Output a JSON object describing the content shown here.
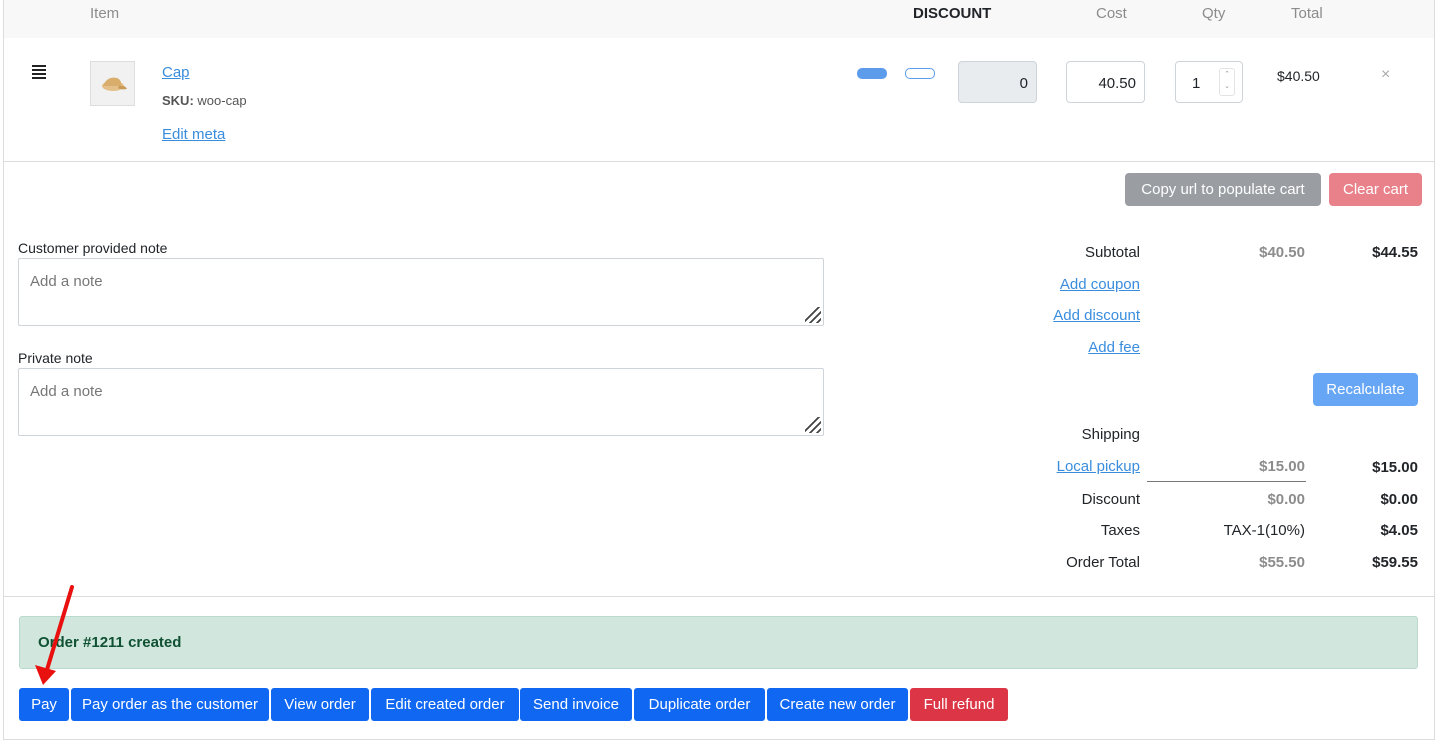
{
  "table_header": {
    "item": "Item",
    "discount": "DISCOUNT",
    "cost": "Cost",
    "qty": "Qty",
    "total": "Total"
  },
  "line_item": {
    "name": "Cap",
    "sku_label": "SKU:",
    "sku": "woo-cap",
    "edit_meta": "Edit meta",
    "discount_value": "0",
    "cost_value": "40.50",
    "qty_value": "1",
    "total": "$40.50",
    "remove_symbol": "×"
  },
  "cart_actions": {
    "copy_url": "Copy url to populate cart",
    "clear_cart": "Clear cart"
  },
  "notes": {
    "customer_label": "Customer provided note",
    "customer_placeholder": "Add a note",
    "private_label": "Private note",
    "private_placeholder": "Add a note"
  },
  "totals": {
    "subtotal_label": "Subtotal",
    "subtotal_orig": "$40.50",
    "subtotal_final": "$44.55",
    "add_coupon": "Add coupon",
    "add_discount": "Add discount",
    "add_fee": "Add fee",
    "recalculate": "Recalculate",
    "shipping_label": "Shipping",
    "shipping_method": "Local pickup",
    "shipping_orig": "$15.00",
    "shipping_final": "$15.00",
    "discount_label": "Discount",
    "discount_orig": "$0.00",
    "discount_final": "$0.00",
    "taxes_label": "Taxes",
    "taxes_name": "TAX-1(10%)",
    "taxes_final": "$4.05",
    "order_total_label": "Order Total",
    "order_total_orig": "$55.50",
    "order_total_final": "$59.55"
  },
  "alert": {
    "message": "Order #1211 created"
  },
  "order_buttons": {
    "pay": "Pay",
    "pay_as_customer": "Pay order as the customer",
    "view_order": "View order",
    "edit_order": "Edit created order",
    "send_invoice": "Send invoice",
    "duplicate": "Duplicate order",
    "create_new": "Create new order",
    "full_refund": "Full refund"
  },
  "colors": {
    "primary": "#1068f2",
    "danger": "#dc3545",
    "success_bg": "#d1e7dd",
    "link": "#3a8ddd",
    "annotation_arrow": "#e8110f"
  }
}
